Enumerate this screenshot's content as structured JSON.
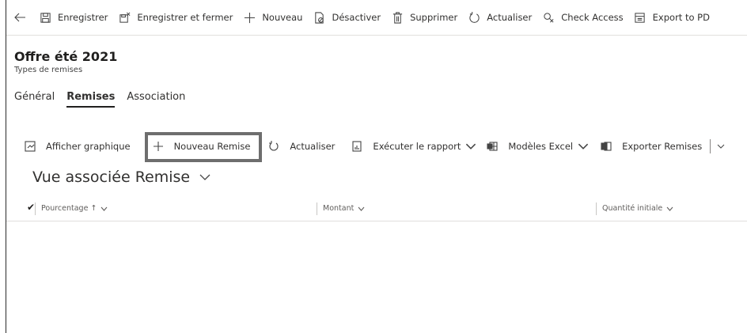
{
  "commandbar": {
    "back_icon": "back-arrow-icon",
    "items": [
      {
        "label": "Enregistrer",
        "icon": "save-icon"
      },
      {
        "label": "Enregistrer et fermer",
        "icon": "save-close-icon"
      },
      {
        "label": "Nouveau",
        "icon": "plus-icon"
      },
      {
        "label": "Désactiver",
        "icon": "deactivate-icon"
      },
      {
        "label": "Supprimer",
        "icon": "trash-icon"
      },
      {
        "label": "Actualiser",
        "icon": "refresh-icon"
      },
      {
        "label": "Check Access",
        "icon": "check-access-icon"
      },
      {
        "label": "Export to PD",
        "icon": "pdf-icon"
      }
    ]
  },
  "header": {
    "title": "Offre été 2021",
    "subtitle": "Types de remises"
  },
  "tabs": [
    {
      "label": "Général",
      "active": false
    },
    {
      "label": "Remises",
      "active": true
    },
    {
      "label": "Association",
      "active": false
    }
  ],
  "subgrid_bar": {
    "items": [
      {
        "label": "Afficher graphique",
        "icon": "chart-icon",
        "dropdown": false
      },
      {
        "label": "Nouveau Remise",
        "icon": "plus-icon",
        "dropdown": false,
        "highlighted": true
      },
      {
        "label": "Actualiser",
        "icon": "refresh-icon",
        "dropdown": false
      },
      {
        "label": "Exécuter le rapport",
        "icon": "report-icon",
        "dropdown": true
      },
      {
        "label": "Modèles Excel",
        "icon": "excel-template-icon",
        "dropdown": true
      },
      {
        "label": "Exporter Remises",
        "icon": "excel-export-icon",
        "dropdown": false
      }
    ]
  },
  "view": {
    "label": "Vue associée Remise"
  },
  "grid": {
    "columns": [
      {
        "label": "Pourcentage ↑"
      },
      {
        "label": "Montant"
      },
      {
        "label": "Quantité initiale"
      }
    ],
    "rows": []
  },
  "colors": {
    "highlight_border": "#6e6e6e",
    "text": "#323130"
  }
}
